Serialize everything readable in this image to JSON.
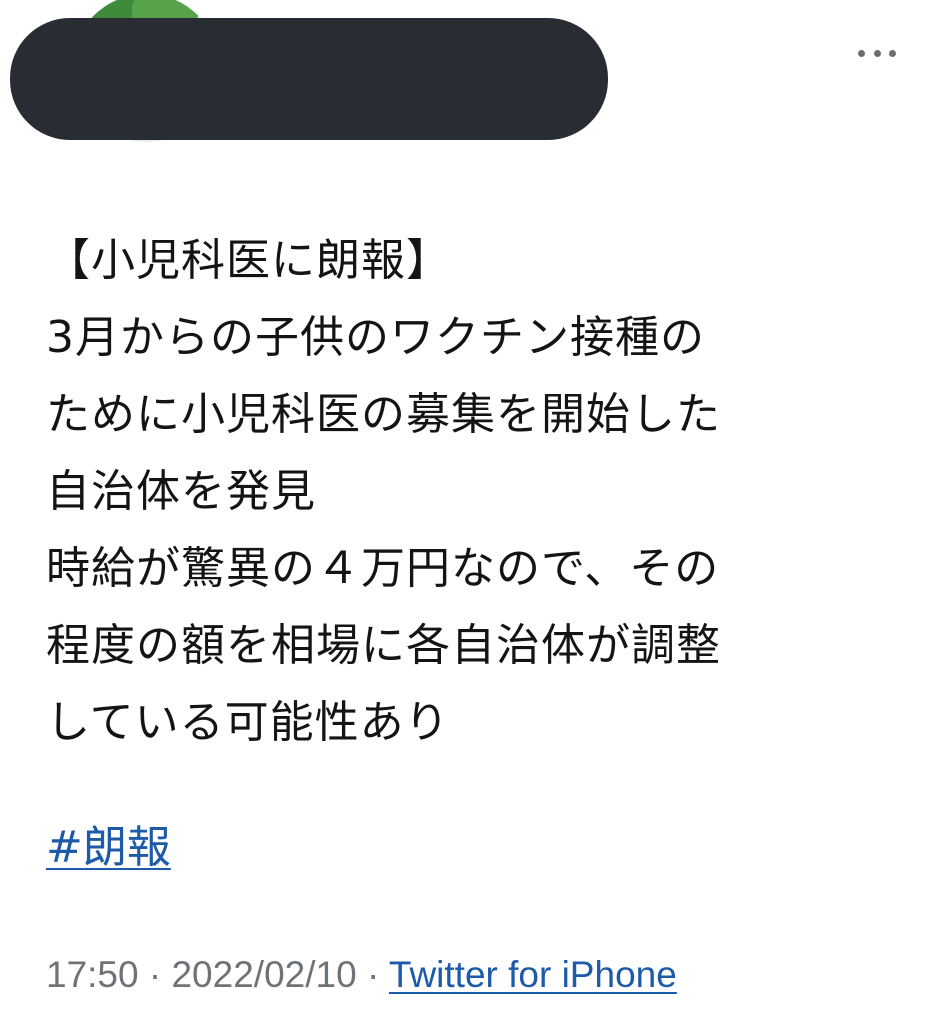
{
  "tweet": {
    "body_lines": [
      "【小児科医に朗報】",
      "3月からの子供のワクチン接種の",
      "ために小児科医の募集を開始した",
      "自治体を発見",
      "時給が驚異の４万円なので、その",
      "程度の額を相場に各自治体が調整",
      "している可能性あり"
    ],
    "hashtag": "#朗報",
    "time": "17:50",
    "separator": " · ",
    "date": "2022/02/10",
    "source": "Twitter for iPhone"
  },
  "icons": {
    "more": "more-horizontal-icon",
    "avatar": "avatar-image"
  },
  "colors": {
    "link": "#1d5aa8",
    "meta_text": "#6e7378",
    "redaction": "#282d33"
  }
}
